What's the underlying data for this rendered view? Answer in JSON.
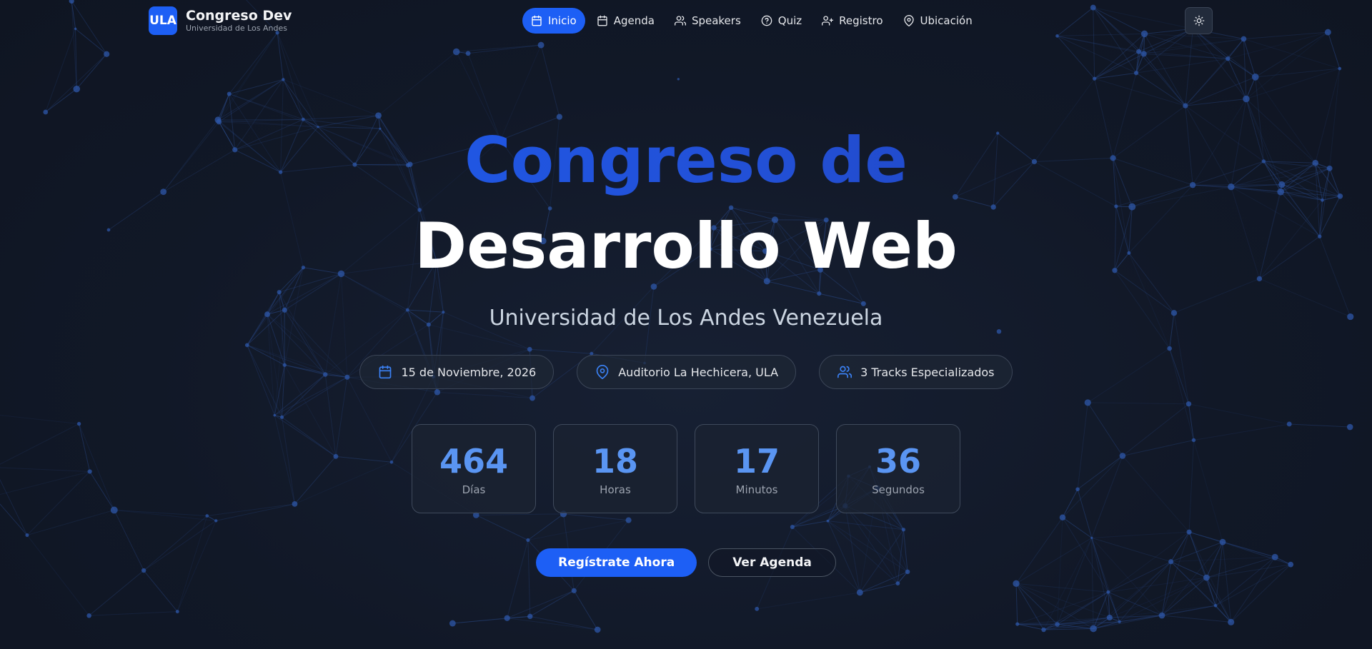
{
  "brand": {
    "logo_text": "ULA",
    "title": "Congreso Dev",
    "subtitle": "Universidad de Los Andes"
  },
  "nav": {
    "items": [
      {
        "label": "Inicio",
        "icon": "calendar-icon",
        "active": true
      },
      {
        "label": "Agenda",
        "icon": "calendar-icon",
        "active": false
      },
      {
        "label": "Speakers",
        "icon": "users-icon",
        "active": false
      },
      {
        "label": "Quiz",
        "icon": "help-circle-icon",
        "active": false
      },
      {
        "label": "Registro",
        "icon": "user-plus-icon",
        "active": false
      },
      {
        "label": "Ubicación",
        "icon": "map-pin-icon",
        "active": false
      }
    ],
    "theme_toggle_icon": "sun-icon"
  },
  "hero": {
    "title_line_1": "Congreso de",
    "title_line_2": "Desarrollo Web",
    "subtitle": "Universidad de Los Andes Venezuela"
  },
  "info": {
    "date": "15 de Noviembre, 2026",
    "location": "Auditorio La Hechicera, ULA",
    "tracks": "3 Tracks Especializados"
  },
  "countdown": [
    {
      "value": "464",
      "label": "Días"
    },
    {
      "value": "18",
      "label": "Horas"
    },
    {
      "value": "17",
      "label": "Minutos"
    },
    {
      "value": "36",
      "label": "Segundos"
    }
  ],
  "cta": {
    "primary_label": "Regístrate Ahora",
    "secondary_label": "Ver Agenda"
  },
  "colors": {
    "accent": "#1d5ff5",
    "background": "#111827",
    "counter_value": "#5a95f2",
    "network_line": "#2a4a8a",
    "network_node": "#2d57a8"
  }
}
